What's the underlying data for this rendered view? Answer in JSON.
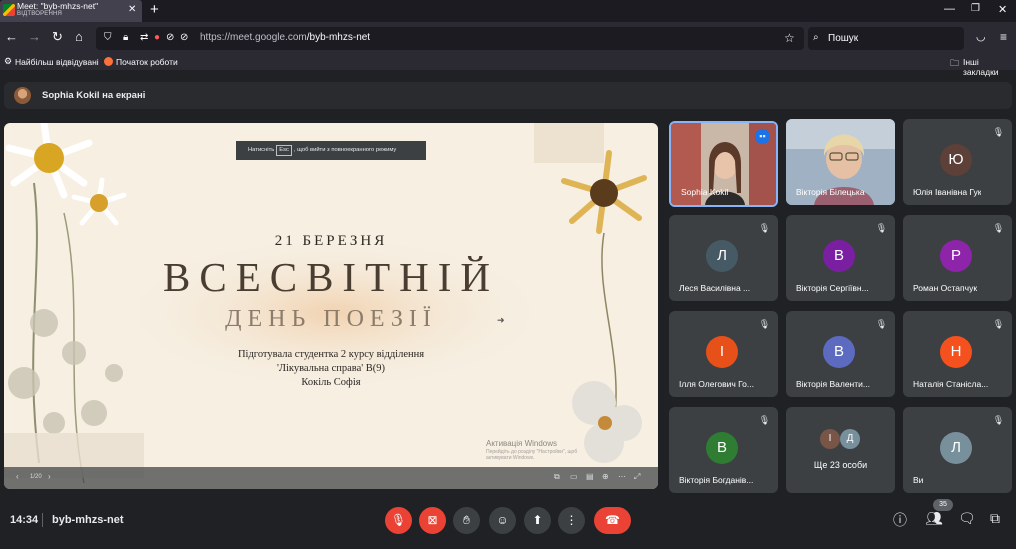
{
  "browser": {
    "tab_title": "Meet: \"byb-mhzs-net\"",
    "tab_subtitle": "ВІДТВОРЕННЯ",
    "url_prefix": "https://meet.google.com",
    "url_path": "/byb-mhzs-net",
    "search_placeholder": "Пошук",
    "bookmarks": {
      "most_visited": "Найбільш відвідувані",
      "getting_started": "Початок роботи",
      "other": "Інші закладки"
    }
  },
  "meet": {
    "presenting_banner": "Sophia Kokil на екрані",
    "slide": {
      "fullscreen_hint_before": "Натисніть",
      "fullscreen_hint_key": "Esc",
      "fullscreen_hint_after": ", щоб вийти з повноекранного режиму",
      "date": "21 БЕРЕЗНЯ",
      "title": "ВСЕСВІТНІЙ",
      "subtitle": "ДЕНЬ ПОЕЗІЇ",
      "line1": "Підготувала студентка 2 курсу  відділення",
      "line2": "'Лікувальна справа' В(9)",
      "line3": "Кокіль Софія",
      "activation_title": "Активація Windows",
      "activation_text": "Перейдіть до розділу \"Настройки\", щоб активувати Windows.",
      "page_counter": "1/20"
    },
    "participants": [
      {
        "name": "Sophia Kokil",
        "initial": "",
        "color": "",
        "speaking": true
      },
      {
        "name": "Вікторія Білецька",
        "initial": "",
        "color": ""
      },
      {
        "name": "Юлія Іванівна Гук",
        "initial": "Ю",
        "color": "#5d4037"
      },
      {
        "name": "Леся Василівна ...",
        "initial": "Л",
        "color": "#455a64"
      },
      {
        "name": "Вікторія Сергіївн...",
        "initial": "В",
        "color": "#7b1fa2"
      },
      {
        "name": "Роман Остапчук",
        "initial": "Р",
        "color": "#8e24aa"
      },
      {
        "name": "Ілля Олегович Го...",
        "initial": "І",
        "color": "#e8501a"
      },
      {
        "name": "Вікторія Валенти...",
        "initial": "В",
        "color": "#5c6bc0"
      },
      {
        "name": "Наталія Станісла...",
        "initial": "Н",
        "color": "#f4511e"
      },
      {
        "name": "Вікторія Богданів...",
        "initial": "В",
        "color": "#2e7d32"
      },
      {
        "name": "Ще 23 особи",
        "initial": "",
        "color": "",
        "others": [
          "І",
          "Д"
        ],
        "others_colors": [
          "#795548",
          "#78909c"
        ]
      },
      {
        "name": "Ви",
        "initial": "Л",
        "color": "#78909c"
      }
    ],
    "bottom": {
      "time": "14:34",
      "meeting_code": "byb-mhzs-net",
      "participants_count": "35"
    }
  },
  "colors": {
    "meet_bg": "#202124",
    "tile_bg": "#3c4043",
    "danger": "#ea4335",
    "active_speaker_border": "#8ab4f8"
  }
}
